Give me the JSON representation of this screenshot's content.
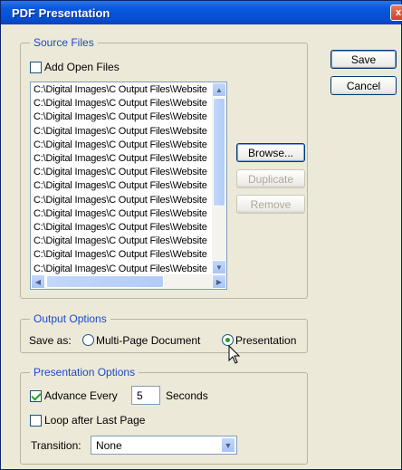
{
  "window": {
    "title": "PDF Presentation",
    "close_label": "x"
  },
  "source_files": {
    "legend": "Source Files",
    "add_open_files": {
      "label": "Add Open Files",
      "checked": false
    },
    "files": [
      "C:\\Digital Images\\C Output Files\\Website",
      "C:\\Digital Images\\C Output Files\\Website",
      "C:\\Digital Images\\C Output Files\\Website",
      "C:\\Digital Images\\C Output Files\\Website",
      "C:\\Digital Images\\C Output Files\\Website",
      "C:\\Digital Images\\C Output Files\\Website",
      "C:\\Digital Images\\C Output Files\\Website",
      "C:\\Digital Images\\C Output Files\\Website",
      "C:\\Digital Images\\C Output Files\\Website",
      "C:\\Digital Images\\C Output Files\\Website",
      "C:\\Digital Images\\C Output Files\\Website",
      "C:\\Digital Images\\C Output Files\\Website",
      "C:\\Digital Images\\C Output Files\\Website",
      "C:\\Digital Images\\C Output Files\\Website"
    ],
    "browse_label": "Browse...",
    "duplicate_label": "Duplicate",
    "remove_label": "Remove"
  },
  "buttons": {
    "save_label": "Save",
    "cancel_label": "Cancel"
  },
  "output_options": {
    "legend": "Output Options",
    "save_as_label": "Save as:",
    "multi_page_label": "Multi-Page Document",
    "presentation_label": "Presentation",
    "selected": "Presentation"
  },
  "presentation_options": {
    "legend": "Presentation Options",
    "advance_label": "Advance Every",
    "advance_checked": true,
    "advance_value": "5",
    "seconds_label": "Seconds",
    "loop_label": "Loop after Last Page",
    "loop_checked": false,
    "transition_label": "Transition:",
    "transition_value": "None"
  },
  "colors": {
    "title_bar": "#0a5adc",
    "dialog_bg": "#ece9d8",
    "legend_text": "#1c4ac6"
  },
  "icons": [
    "close-icon",
    "scroll-up-icon",
    "scroll-down-icon",
    "scroll-left-icon",
    "scroll-right-icon",
    "dropdown-arrow-icon",
    "mouse-cursor-icon"
  ]
}
